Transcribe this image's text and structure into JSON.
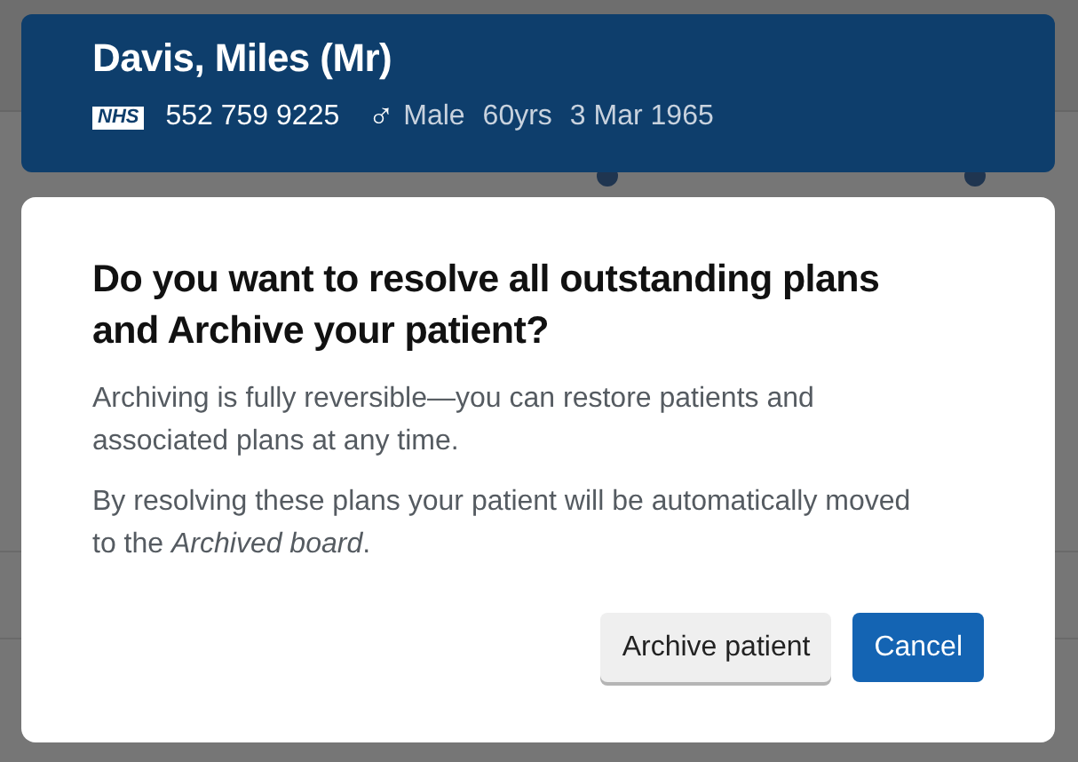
{
  "patient_banner": {
    "name": "Davis, Miles (Mr)",
    "nhs_logo": "NHS",
    "nhs_number": "552 759 9225",
    "sex_symbol": "♂",
    "sex": "Male",
    "age": "60yrs",
    "dob": "3 Mar 1965"
  },
  "dialog": {
    "title": "Do you want to resolve all outstanding plans and Archive your patient?",
    "paragraphs": [
      "Archiving is fully reversible—you can restore patients and associated plans at any time.",
      "By resolving these plans your patient will be automatically moved to the *Archived board*."
    ],
    "buttons": [
      {
        "label": "Archive patient",
        "kind": "secondary"
      },
      {
        "label": "Cancel",
        "kind": "primary"
      }
    ]
  }
}
